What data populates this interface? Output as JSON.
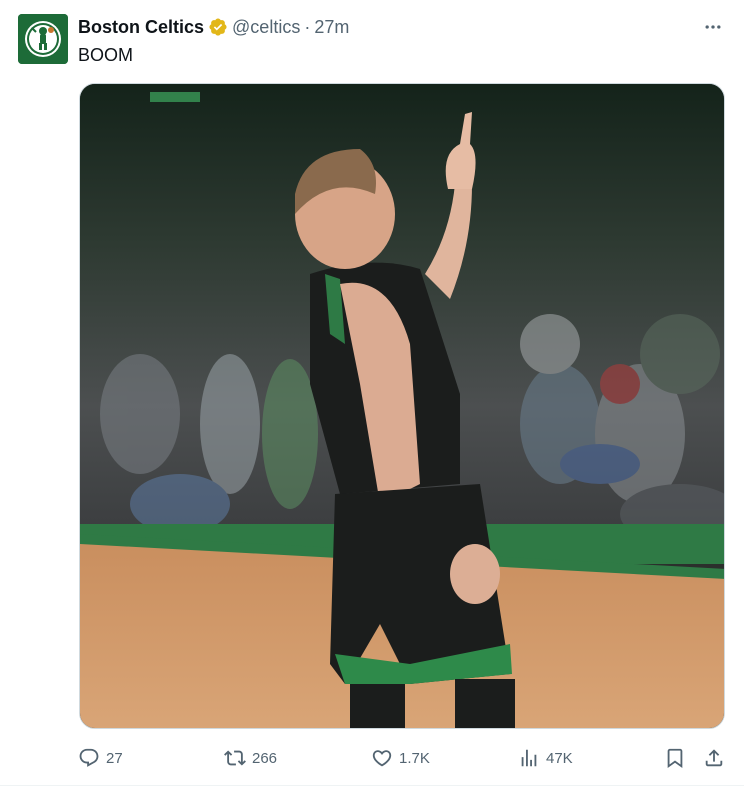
{
  "author": {
    "display_name": "Boston Celtics",
    "handle": "@celtics",
    "verified": true,
    "verified_color": "#e2b719",
    "avatar_icon": "celtics-logo-icon",
    "avatar_bg": "#1d6b38"
  },
  "tweet": {
    "separator": "·",
    "time_ago": "27m",
    "text": "BOOM"
  },
  "media": {
    "type": "image",
    "icon": "photo-basketball-player-celebrating"
  },
  "actions": {
    "reply": {
      "icon": "reply-icon",
      "count": "27"
    },
    "repost": {
      "icon": "repost-icon",
      "count": "266"
    },
    "like": {
      "icon": "heart-icon",
      "count": "1.7K"
    },
    "views": {
      "icon": "views-icon",
      "count": "47K"
    },
    "bookmark": {
      "icon": "bookmark-icon"
    },
    "share": {
      "icon": "share-icon"
    }
  },
  "colors": {
    "text_primary": "#0f1419",
    "text_secondary": "#536471",
    "border": "#cfd9de"
  }
}
